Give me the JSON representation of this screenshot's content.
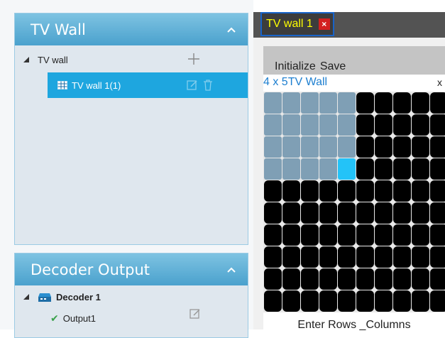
{
  "tv_wall_panel": {
    "title": "TV Wall",
    "tree": {
      "root_label": "TV wall",
      "child_label": "TV wall 1(1)"
    }
  },
  "decoder_panel": {
    "title": "Decoder Output",
    "decoder_label": "Decoder 1",
    "output_label": "Output1"
  },
  "tab": {
    "label": "TV wall 1",
    "close_glyph": "×"
  },
  "wall_window": {
    "toolbar": {
      "initialize": "Initialize",
      "save": "Save"
    },
    "title": "4 x 5TV Wall",
    "close_glyph": "x",
    "footer": "Enter Rows _Columns",
    "grid": {
      "selected_rows": 4,
      "selected_cols": 5
    }
  },
  "colors": {
    "accent": "#1ea6df",
    "grid_selected": "#7f9fb5",
    "grid_current": "#23c3f8",
    "grid_empty": "#000000"
  }
}
